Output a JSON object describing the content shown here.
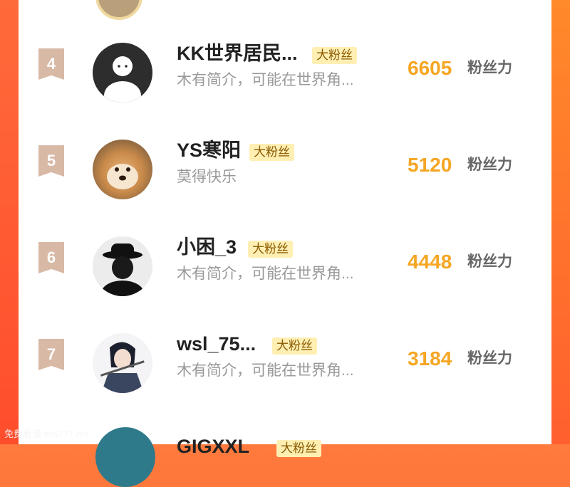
{
  "ranking": {
    "count_label": "粉丝力",
    "badge_label": "大粉丝",
    "rows": [
      {
        "rank": "4",
        "name": "KK世界居民...",
        "bio": "木有简介，可能在世界角...",
        "count": "6605"
      },
      {
        "rank": "5",
        "name": "YS寒阳",
        "bio": "莫得快乐",
        "count": "5120"
      },
      {
        "rank": "6",
        "name": "小困_3",
        "bio": "木有简介，可能在世界角...",
        "count": "4448"
      },
      {
        "rank": "7",
        "name": "wsl_75...",
        "bio": "木有简介，可能在世界角...",
        "count": "3184"
      }
    ],
    "partial_next_name": "GIGXXL"
  },
  "watermark": "免费看漫 mw777.me"
}
